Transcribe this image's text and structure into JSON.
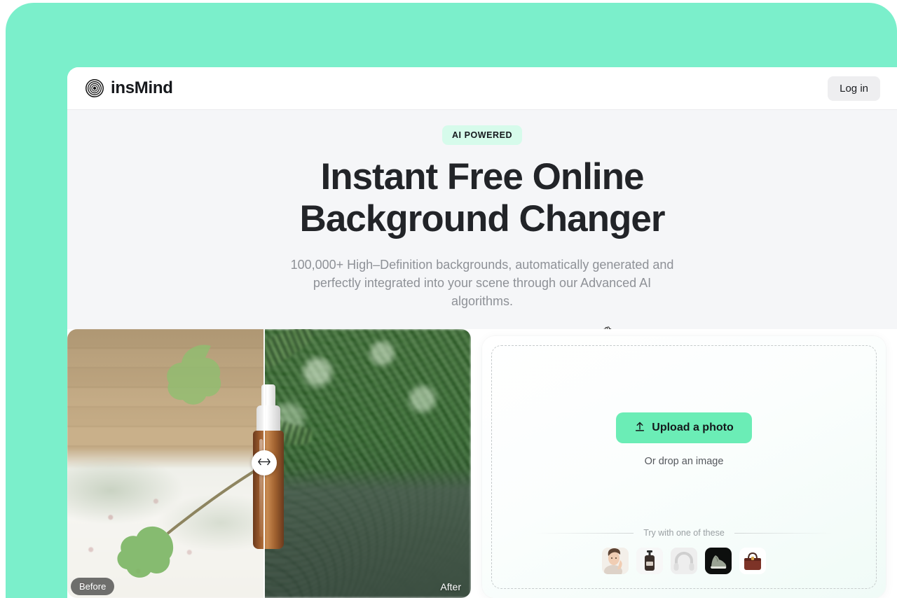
{
  "header": {
    "brand_name": "insMind",
    "brand_icon": "concentric-circles-logo-icon",
    "login_label": "Log in"
  },
  "hero": {
    "badge": "AI POWERED",
    "title_line1": "Instant Free Online",
    "title_line2": "Background Changer",
    "subtitle": "100,000+ High–Definition backgrounds, automatically generated and perfectly integrated into your scene through our Advanced AI algorithms.",
    "cursor_icon": "open-hand-cursor-icon"
  },
  "comparison": {
    "before_label": "Before",
    "after_label": "After",
    "slider_icon": "left-right-arrow-icon",
    "before_description": "serum dropper bottle on white lace tablecloth with ivy leaf and wooden wall",
    "after_description": "serum dropper bottle in tropical jungle with ferns and rippling water"
  },
  "upload": {
    "button_label": "Upload a photo",
    "button_icon": "upload-arrow-icon",
    "drop_hint": "Or drop an image",
    "try_label": "Try with one of these",
    "samples": [
      {
        "name": "sample-woman-portrait",
        "alt": "woman touching face"
      },
      {
        "name": "sample-cosmetic-bottle",
        "alt": "dark pump bottle"
      },
      {
        "name": "sample-headphones",
        "alt": "white headphones"
      },
      {
        "name": "sample-sneaker",
        "alt": "sneaker on dark background"
      },
      {
        "name": "sample-handbag",
        "alt": "brown leather handbag"
      }
    ]
  },
  "colors": {
    "mint_background": "#7BEFCB",
    "accent_button": "#6BEDB6",
    "badge_background": "#D6FBEB",
    "hero_background": "#F5F6F8",
    "heading_text": "#222428",
    "muted_text": "#8E9197"
  }
}
